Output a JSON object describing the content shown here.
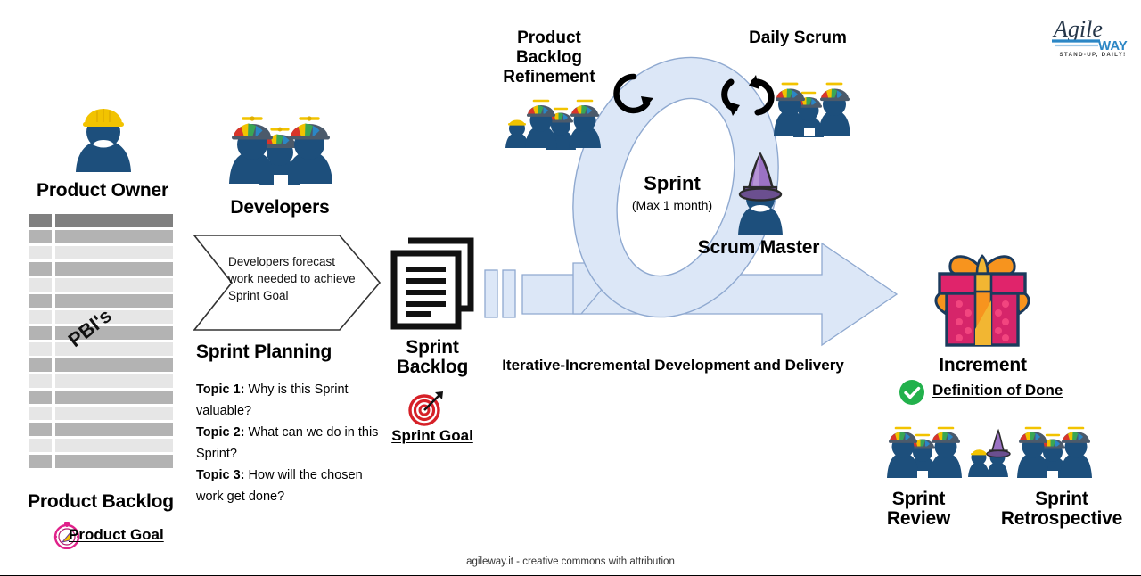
{
  "logo": {
    "name_main": "Agile",
    "name_sub": "WAY",
    "tagline": "STAND-UP, DAILY!"
  },
  "roles": {
    "product_owner": "Product Owner",
    "developers": "Developers",
    "scrum_master": "Scrum Master"
  },
  "product_backlog": {
    "title": "Product Backlog",
    "items_label": "PBI's",
    "goal_label": "Product Goal",
    "goal_icon": "compass-icon",
    "row_count": 17
  },
  "sprint_planning": {
    "callout": "Developers forecast work needed to achieve Sprint Goal",
    "title": "Sprint Planning",
    "topics": [
      {
        "label": "Topic 1:",
        "text": " Why is this Sprint valuable?"
      },
      {
        "label": "Topic 2:",
        "text": " What can we do in this Sprint?"
      },
      {
        "label": "Topic 3:",
        "text": " How will the chosen work get done?"
      }
    ]
  },
  "sprint_backlog": {
    "title_line1": "Sprint",
    "title_line2": "Backlog",
    "goal_label": "Sprint Goal",
    "goal_icon": "target-icon",
    "doc_icon": "document-stack-icon"
  },
  "sprint_loop": {
    "title": "Sprint",
    "subtitle": "(Max 1 month)",
    "refinement_label": "Product Backlog Refinement",
    "daily_scrum_label": "Daily Scrum",
    "refinement_icon": "circular-arrow-icon",
    "daily_scrum_icon": "cyclic-arrows-icon"
  },
  "delivery": {
    "label": "Iterative-Incremental Development and Delivery"
  },
  "increment": {
    "title": "Increment",
    "dod_label": "Definition of Done",
    "dod_icon": "check-circle-icon",
    "gift_icon": "gift-box-icon"
  },
  "events": {
    "review_line1": "Sprint",
    "review_line2": "Review",
    "retro_line1": "Sprint",
    "retro_line2": "Retrospective"
  },
  "footer": {
    "attribution": "agileway.it - creative commons with attribution"
  },
  "colors": {
    "person_navy": "#1d4f7c",
    "po_hat_yellow": "#f2c300",
    "loop_blue_fill": "#dce7f7",
    "loop_blue_stroke": "#8fa9d0",
    "gift_pink": "#d6256a",
    "gift_orange": "#f7941e",
    "done_green": "#22b14c",
    "goal_pink": "#e0218a",
    "target_red": "#d62027",
    "wizard_purple": "#9b72c4",
    "logo_blue": "#2b86c5",
    "backlog_gray_dark": "#808080",
    "backlog_gray_mid": "#b3b3b3",
    "backlog_gray_light": "#e6e6e6"
  }
}
